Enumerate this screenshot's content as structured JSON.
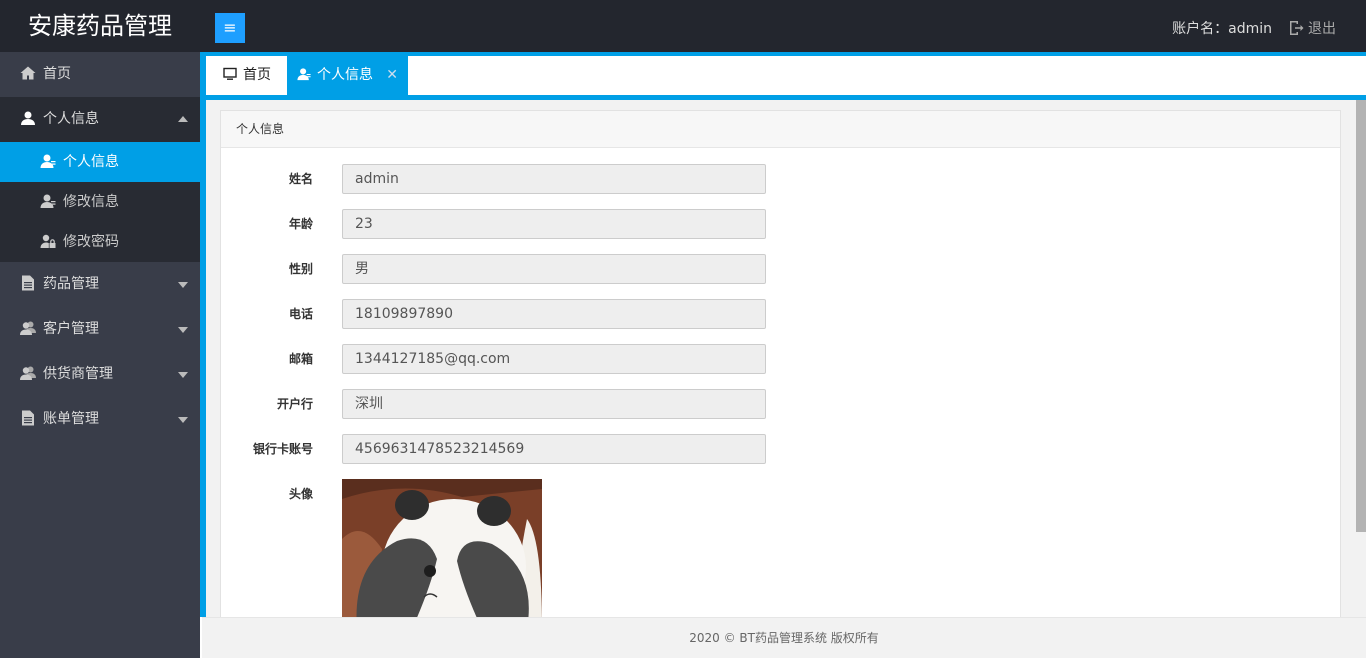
{
  "brand": "安康药品管理",
  "header": {
    "account_label": "账户名：admin",
    "logout_label": "退出"
  },
  "sidebar": {
    "home": "首页",
    "personal": "个人信息",
    "personal_items": [
      "个人信息",
      "修改信息",
      "修改密码"
    ],
    "drug": "药品管理",
    "customer": "客户管理",
    "supplier": "供货商管理",
    "bill": "账单管理"
  },
  "tabs": {
    "home": "首页",
    "active": "个人信息"
  },
  "panel": {
    "title": "个人信息",
    "fields": [
      {
        "label": "姓名",
        "value": "admin"
      },
      {
        "label": "年龄",
        "value": "23"
      },
      {
        "label": "性别",
        "value": "男"
      },
      {
        "label": "电话",
        "value": "18109897890"
      },
      {
        "label": "邮箱",
        "value": "1344127185@qq.com"
      },
      {
        "label": "开户行",
        "value": "深圳"
      },
      {
        "label": "银行卡账号",
        "value": "4569631478523214569"
      }
    ],
    "avatar_label": "头像"
  },
  "footer": "2020 © BT药品管理系统 版权所有",
  "colors": {
    "accent": "#009fe6",
    "header_bg": "#23262e",
    "sidebar_bg": "#393d49"
  }
}
